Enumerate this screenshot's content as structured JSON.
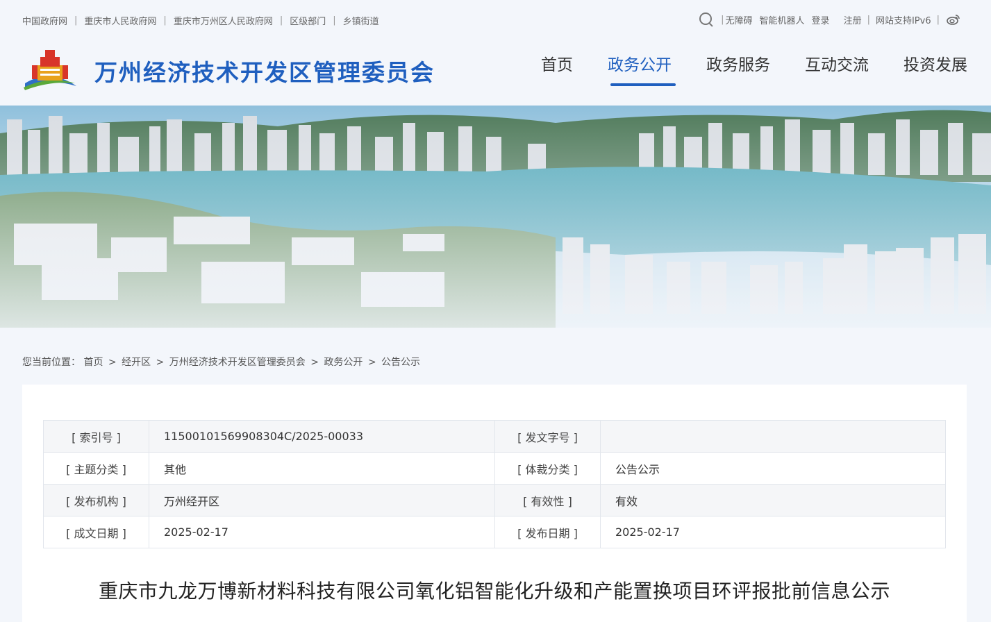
{
  "top_links": [
    "中国政府网",
    "重庆市人民政府网",
    "重庆市万州区人民政府网",
    "区级部门",
    "乡镇街道"
  ],
  "toolbar": {
    "search_icon": "search-icon",
    "accessibility": "无障碍",
    "robot": "智能机器人",
    "login": "登录",
    "register": "注册",
    "ipv6": "网站支持IPv6",
    "weibo_icon": "weibo-icon"
  },
  "header": {
    "title": "万州经济技术开发区管理委员会",
    "nav": [
      "首页",
      "政务公开",
      "政务服务",
      "互动交流",
      "投资发展"
    ],
    "active_nav": "政务公开",
    "accent_color": "#1f5fbf"
  },
  "breadcrumb": {
    "prefix": "您当前位置：",
    "items": [
      "首页",
      "经开区",
      "万州经济技术开发区管理委员会",
      "政务公开",
      "公告公示"
    ],
    "separator": ">"
  },
  "meta": {
    "rows": [
      [
        "[ 索引号 ]",
        "11500101569908304C/2025-00033",
        "[ 发文字号 ]",
        ""
      ],
      [
        "[ 主题分类 ]",
        "其他",
        "[ 体裁分类 ]",
        "公告公示"
      ],
      [
        "[ 发布机构 ]",
        "万州经开区",
        "[ 有效性 ]",
        "有效"
      ],
      [
        "[ 成文日期 ]",
        "2025-02-17",
        "[ 发布日期 ]",
        "2025-02-17"
      ]
    ]
  },
  "document": {
    "title": "重庆市九龙万博新材料科技有限公司氧化铝智能化升级和产能置换项目环评报批前信息公示"
  }
}
